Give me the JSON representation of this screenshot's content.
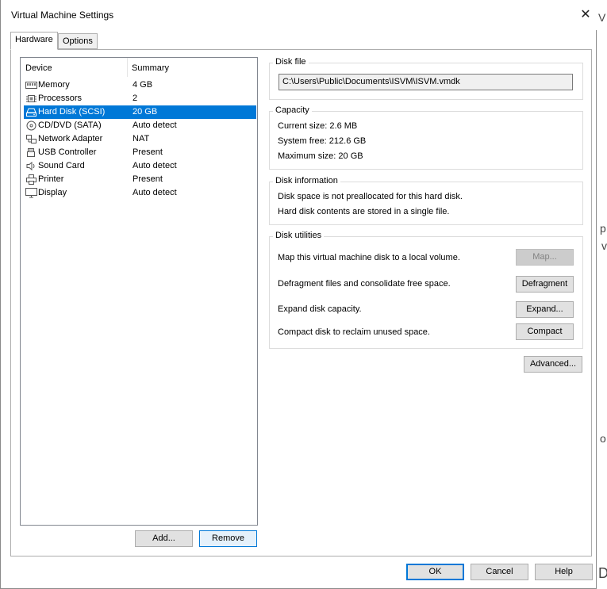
{
  "window": {
    "title": "Virtual Machine Settings",
    "close_glyph": "✕"
  },
  "tabs": [
    {
      "label": "Hardware",
      "active": true
    },
    {
      "label": "Options",
      "active": false
    }
  ],
  "device_list": {
    "headers": {
      "device": "Device",
      "summary": "Summary"
    },
    "rows": [
      {
        "name": "Memory",
        "summary": "4 GB",
        "icon": "memory-icon"
      },
      {
        "name": "Processors",
        "summary": "2",
        "icon": "processor-icon"
      },
      {
        "name": "Hard Disk (SCSI)",
        "summary": "20 GB",
        "icon": "hard-disk-icon",
        "selected": true
      },
      {
        "name": "CD/DVD (SATA)",
        "summary": "Auto detect",
        "icon": "cd-dvd-icon"
      },
      {
        "name": "Network Adapter",
        "summary": "NAT",
        "icon": "network-adapter-icon"
      },
      {
        "name": "USB Controller",
        "summary": "Present",
        "icon": "usb-icon"
      },
      {
        "name": "Sound Card",
        "summary": "Auto detect",
        "icon": "speaker-icon"
      },
      {
        "name": "Printer",
        "summary": "Present",
        "icon": "printer-icon"
      },
      {
        "name": "Display",
        "summary": "Auto detect",
        "icon": "display-icon"
      }
    ],
    "add_label": "Add...",
    "remove_label": "Remove"
  },
  "disk_file": {
    "title": "Disk file",
    "path": "C:\\Users\\Public\\Documents\\ISVM\\ISVM.vmdk"
  },
  "capacity": {
    "title": "Capacity",
    "current_size": "Current size:  2.6 MB",
    "system_free": "System free:  212.6 GB",
    "maximum_size": "Maximum size:  20 GB"
  },
  "disk_information": {
    "title": "Disk information",
    "line1": "Disk space is not preallocated for this hard disk.",
    "line2": "Hard disk contents are stored in a single file."
  },
  "disk_utilities": {
    "title": "Disk utilities",
    "map_text": "Map this virtual machine disk to a local volume.",
    "map_label": "Map...",
    "defrag_text": "Defragment files and consolidate free space.",
    "defrag_label": "Defragment",
    "expand_text": "Expand disk capacity.",
    "expand_label": "Expand...",
    "compact_text": "Compact disk to reclaim unused space.",
    "compact_label": "Compact"
  },
  "advanced_label": "Advanced...",
  "footer": {
    "ok_label": "OK",
    "cancel_label": "Cancel",
    "help_label": "Help"
  },
  "background_app": {
    "glyph_top": "V",
    "glyph_mid1": "p",
    "glyph_mid2": "v",
    "glyph_low": "o",
    "glyph_bottom": "D"
  },
  "colors": {
    "selection": "#0078d7",
    "button_face": "#e1e1e1",
    "border": "#adadad"
  }
}
